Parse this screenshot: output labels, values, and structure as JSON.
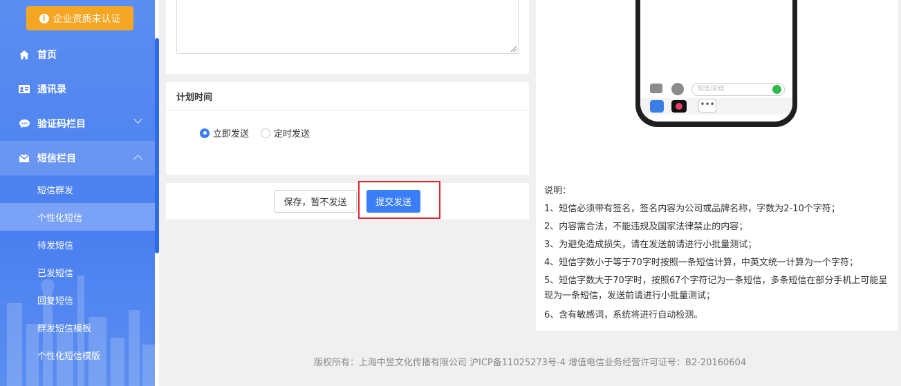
{
  "sidebar": {
    "cert_button": "企业资质未认证",
    "nav": [
      {
        "label": "首页",
        "icon": "home-icon"
      },
      {
        "label": "通讯录",
        "icon": "contact-card-icon"
      },
      {
        "label": "验证码栏目",
        "icon": "chat-bubble-icon"
      },
      {
        "label": "短信栏目",
        "icon": "envelope-icon"
      }
    ],
    "sub_items": [
      {
        "label": "短信群发"
      },
      {
        "label": "个性化短信"
      },
      {
        "label": "待发短信"
      },
      {
        "label": "已发短信"
      },
      {
        "label": "回复短信"
      },
      {
        "label": "群发短信模板"
      },
      {
        "label": "个性化短信模版"
      }
    ],
    "selected_sub": "个性化短信"
  },
  "schedule": {
    "title": "计划时间",
    "options": [
      {
        "label": "立即发送",
        "checked": true
      },
      {
        "label": "定时发送",
        "checked": false
      }
    ]
  },
  "actions": {
    "save_label": "保存，暂不发送",
    "submit_label": "提交发送"
  },
  "phone_preview": {
    "input_placeholder": "短信/彩信",
    "more_label": "•••"
  },
  "notes": {
    "heading": "说明：",
    "items": [
      "1、短信必须带有签名，签名内容为公司或品牌名称，字数为2-10个字符；",
      "2、内容需合法，不能违规及国家法律禁止的内容；",
      "3、为避免造成损失，请在发送前请进行小批量测试；",
      "4、短信字数小于等于70字时按照一条短信计算，中英文统一计算为一个字符；",
      "5、短信字数大于70字时，按照67个字符记为一条短信，多条短信在部分手机上可能呈现为一条短信，发送前请进行小批量测试；",
      "6、含有敏感词，系统将进行自动检测。"
    ]
  },
  "footer": {
    "text": "版权所有：上海中昱文化传播有限公司 沪ICP备11025273号-4 增值电信业务经营许可证号：B2-20160604"
  },
  "colors": {
    "sidebar": "#4a7ff0",
    "cert_button": "#f5a623",
    "primary": "#3a7ef7",
    "highlight": "#e0262c"
  }
}
